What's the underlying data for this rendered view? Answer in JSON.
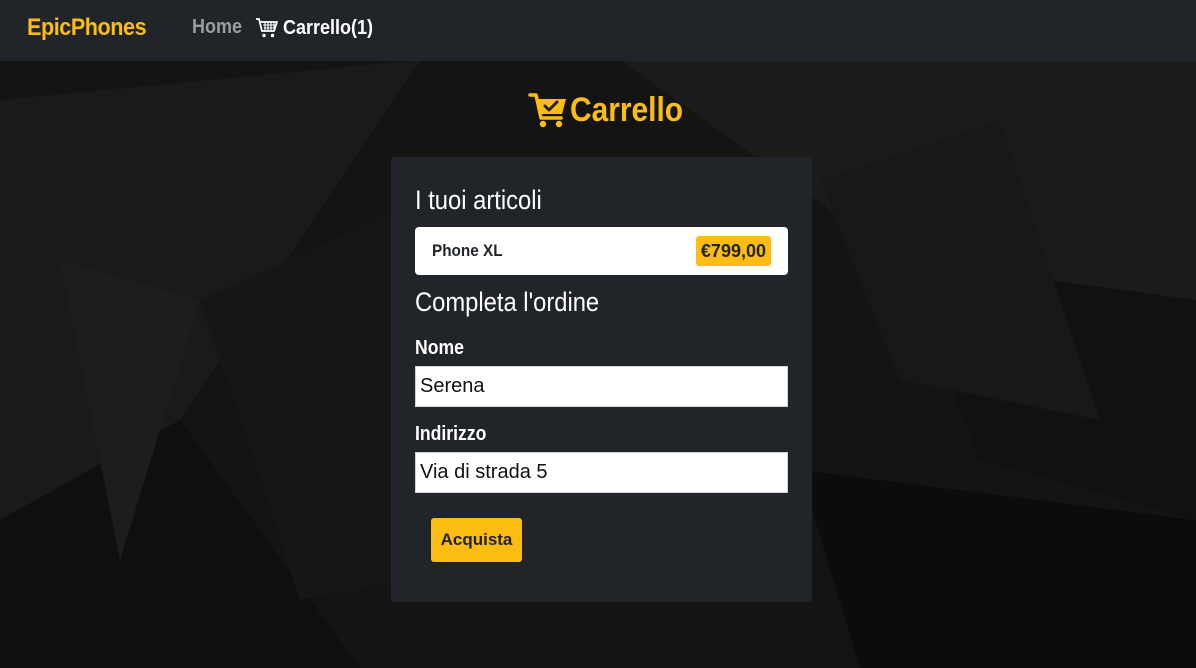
{
  "navbar": {
    "brand": "EpicPhones",
    "home_label": "Home",
    "cart_label": "Carrello(1)",
    "cart_icon": "shopping-cart-icon"
  },
  "page": {
    "title": "Carrello",
    "title_icon": "cart-check-icon"
  },
  "cart": {
    "heading": "I tuoi articoli",
    "items": [
      {
        "name": "Phone XL",
        "price": "€799,00"
      }
    ]
  },
  "order_form": {
    "heading": "Completa l'ordine",
    "name_label": "Nome",
    "name_value": "Serena",
    "address_label": "Indirizzo",
    "address_value": "Via di strada 5",
    "submit_label": "Acquista"
  },
  "colors": {
    "accent": "#fcbc11",
    "navbar_bg": "#212529",
    "card_bg": "#212529",
    "page_bg": "#121212"
  }
}
